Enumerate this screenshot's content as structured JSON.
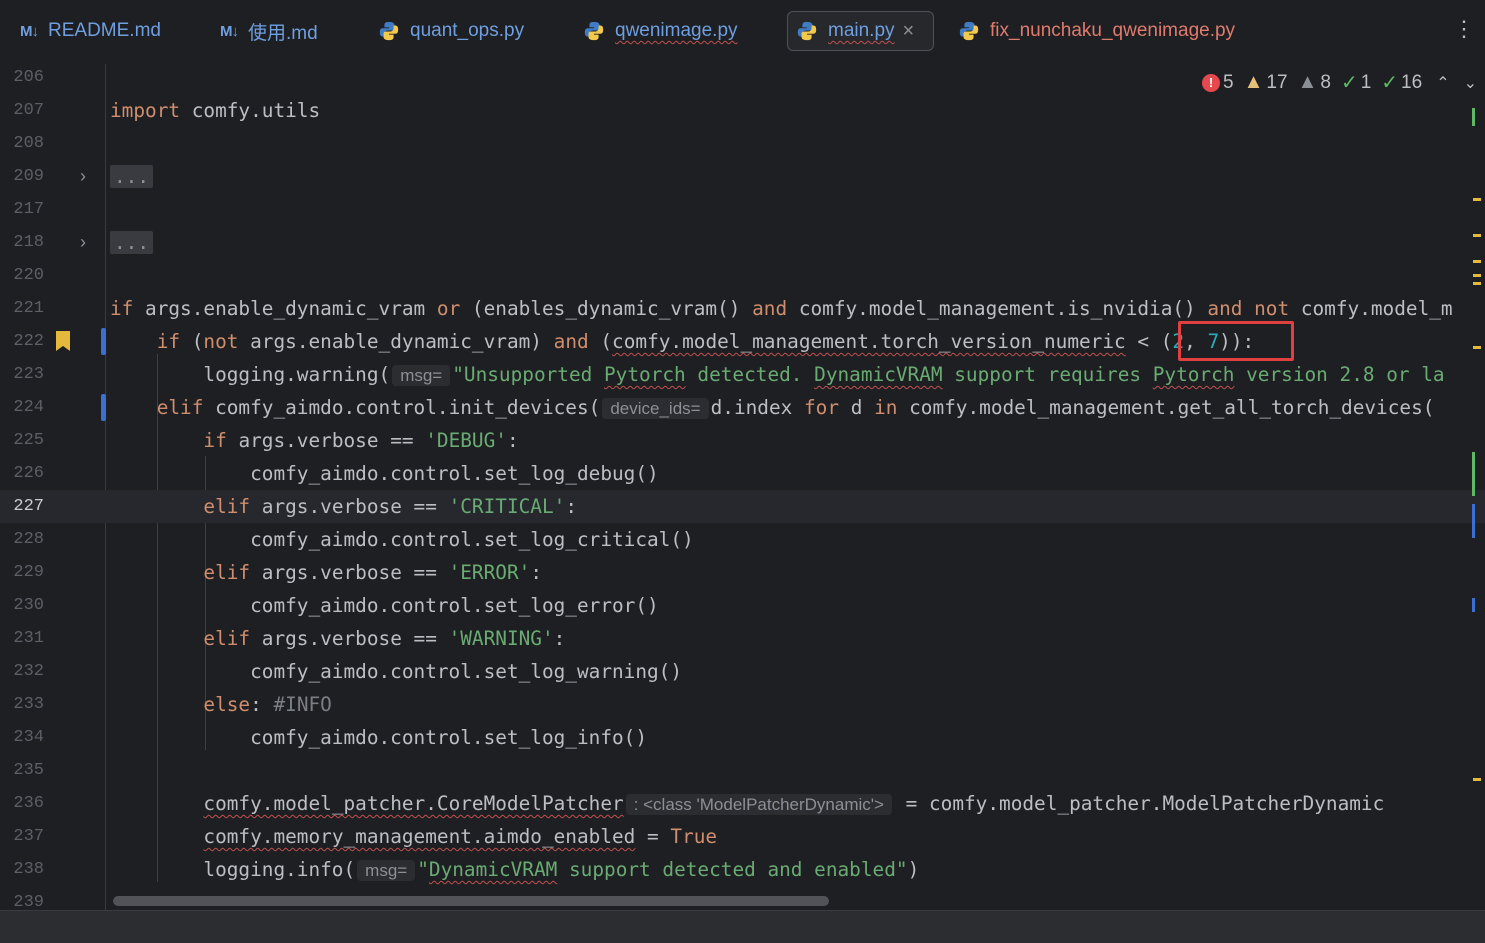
{
  "tabs": [
    {
      "icon": "markdown-icon",
      "prefix": "M↓",
      "label": "README.md"
    },
    {
      "icon": "markdown-icon",
      "prefix": "M↓",
      "label": "使用.md"
    },
    {
      "icon": "python-icon",
      "label": "quant_ops.py"
    },
    {
      "icon": "python-icon",
      "label": "qwenimage.py"
    },
    {
      "icon": "python-icon",
      "label": "main.py",
      "active": true,
      "close": "×"
    },
    {
      "icon": "python-icon",
      "label": "fix_nunchaku_qwenimage.py"
    }
  ],
  "more_menu": "⋮",
  "inspections": {
    "errors": "5",
    "warnings": "17",
    "weak_warnings": "8",
    "typos": "1",
    "passed": "16",
    "up": "⌃",
    "down": "⌄"
  },
  "lines": {
    "l206": "206",
    "l207": "207",
    "l208": "208",
    "l209": "209",
    "l217": "217",
    "l218": "218",
    "l220": "220",
    "l221": "221",
    "l222": "222",
    "l223": "223",
    "l224": "224",
    "l225": "225",
    "l226": "226",
    "l227": "227",
    "l228": "228",
    "l229": "229",
    "l230": "230",
    "l231": "231",
    "l232": "232",
    "l233": "233",
    "l234": "234",
    "l235": "235",
    "l236": "236",
    "l237": "237",
    "l238": "238",
    "l239": "239"
  },
  "code": {
    "import_kw": "import",
    "import_mod": " comfy.utils",
    "folded": "...",
    "hint_msg": "msg=",
    "hint_device": "device_ids=",
    "hint_class": ": <class 'ModelPatcherDynamic'>",
    "str_unsupported": "\"Unsupported ",
    "str_pytorch": "Pytorch",
    "str_detected": " detected. ",
    "str_dynvram": "DynamicVRAM",
    "str_support": " support requires ",
    "str_version": " version 2.8 or la",
    "str_debug": "'DEBUG'",
    "str_critical": "'CRITICAL'",
    "str_error": "'ERROR'",
    "str_warning": "'WARNING'",
    "comment_info": "#INFO",
    "true_kw": "True",
    "str_enabled_q": "\"",
    "str_enabled_rest": " support detected and enabled\""
  }
}
